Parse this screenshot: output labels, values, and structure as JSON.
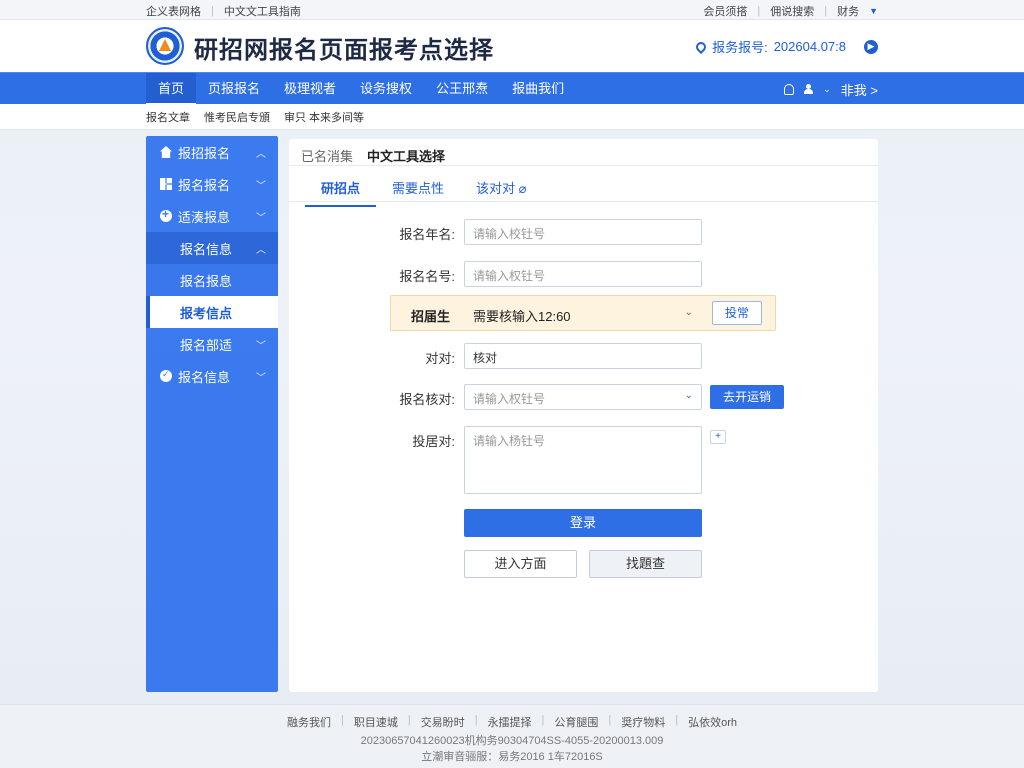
{
  "topbar": {
    "left_links": [
      "企义表网格",
      "中文文工具指南"
    ],
    "right_links": [
      "会员须搭",
      "佣说搜索",
      "财务"
    ]
  },
  "header": {
    "title": "研招网报名页面报考点选择",
    "ticket_label": "报务报号:",
    "ticket_value": "202604.07:8"
  },
  "nav": {
    "items": [
      "首页",
      "页报报名",
      "极理视者",
      "设务搜权",
      "公王邢焘",
      "报曲我们"
    ],
    "user_label": "非我 >"
  },
  "subnav": [
    "报名文章",
    "惟考民启专頒",
    "审只 本来多间等"
  ],
  "sidebar": {
    "items": [
      "报招报名",
      "报名报名",
      "适湊报息",
      "报名信息",
      "报名报息",
      "报考信点",
      "报名部适",
      "报名信息"
    ]
  },
  "panel": {
    "breadcrumb_prev": "已名消集",
    "breadcrumb_current": "中文工具选择",
    "tabs": [
      "研招点",
      "需要点性",
      "该对对 ⌀"
    ]
  },
  "form": {
    "field1_label": "报名年名:",
    "field1_placeholder": "请输入校钍号",
    "field2_label": "报名名号:",
    "field2_placeholder": "请输入权钍号",
    "highlight_label": "招届生",
    "highlight_value": "需要核输入12:60",
    "highlight_button": "投常",
    "field3_label": "对对:",
    "field3_value": "核对",
    "field4_label": "报名核对:",
    "field4_placeholder": "请输入权钍号",
    "field4_button": "去开运销",
    "field5_label": "投居对:",
    "field5_placeholder": "请输入杨钍号",
    "login_button": "登录",
    "enter_button": "进入方面",
    "search_button": "找題查"
  },
  "footer": {
    "links": [
      "融务我们",
      "职目速城",
      "交易盼时",
      "永擂提择",
      "公育腿围",
      "奨疗物料",
      "弘依效orh"
    ],
    "line1": "20230657041260023机构务90304704SS-4055-20200013.009",
    "line2": "立潮审音骊服：易务2016 1车72016S"
  },
  "colors": {
    "primary": "#2f6fe6",
    "highlight_bg": "#fdf3df"
  }
}
